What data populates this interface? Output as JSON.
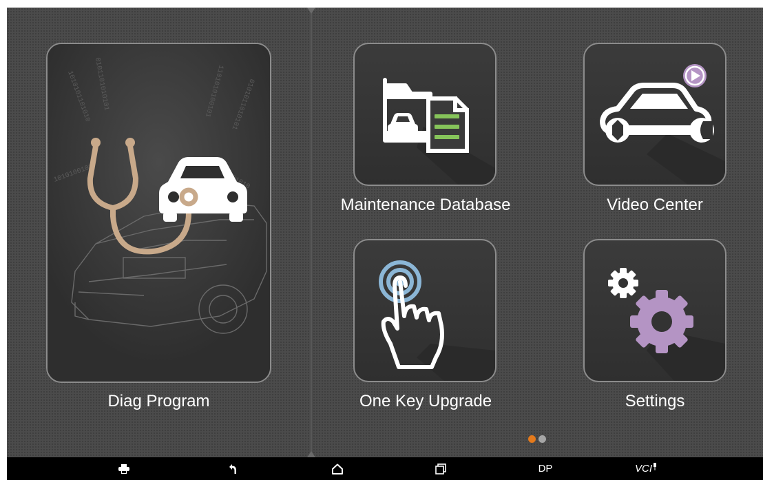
{
  "tiles": {
    "diag_program": {
      "label": "Diag Program",
      "icon": "stethoscope-car-icon"
    },
    "maintenance_database": {
      "label": "Maintenance Database",
      "icon": "folder-document-icon"
    },
    "video_center": {
      "label": "Video Center",
      "icon": "car-wrench-play-icon"
    },
    "one_key_upgrade": {
      "label": "One Key Upgrade",
      "icon": "touch-hand-icon"
    },
    "settings": {
      "label": "Settings",
      "icon": "gears-icon"
    }
  },
  "pager": {
    "current_page": 1,
    "total_pages": 2,
    "active_color": "#e47a1c",
    "inactive_color": "#a6a6a6"
  },
  "navbar": {
    "items": [
      {
        "name": "screenshot",
        "icon": "printer-icon"
      },
      {
        "name": "back",
        "icon": "back-arrow-icon"
      },
      {
        "name": "home",
        "icon": "home-icon"
      },
      {
        "name": "recent",
        "icon": "recent-apps-icon"
      },
      {
        "name": "dp",
        "label": "DP"
      },
      {
        "name": "vci",
        "label": "VCI"
      }
    ]
  },
  "colors": {
    "screen_bg": "#4b4b4b",
    "tile_border": "#8c8c8c",
    "icon_beige": "#c8a98a",
    "icon_purple": "#b494c4",
    "icon_green": "#86c45a",
    "icon_blue": "#8bb6d6"
  }
}
